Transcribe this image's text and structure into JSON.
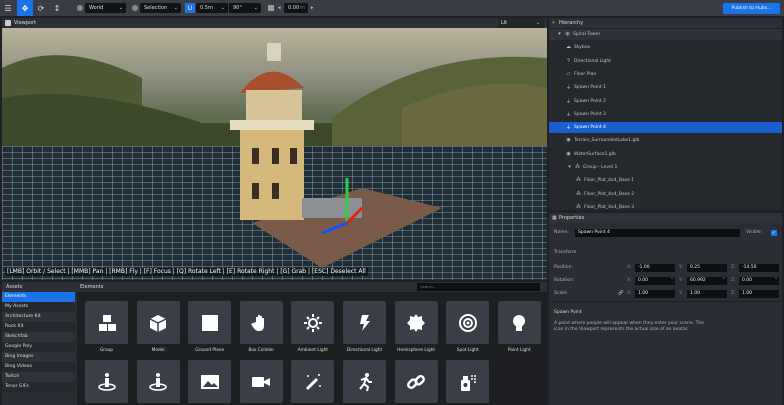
{
  "toolbar": {
    "menu_icon": "menu-icon",
    "move_icon": "move-icon",
    "rotate_icon": "rotate-icon",
    "scale_icon": "scale-icon",
    "space": "World",
    "pivot": "Selection",
    "snap_translate": "0.5m",
    "snap_rotate": "90°",
    "grid_height": "0.00",
    "grid_unit": "m",
    "publish_label": "Publish to Hubs..."
  },
  "viewport": {
    "title": "Viewport",
    "render_mode": "Lit",
    "hint": "[LMB] Orbit / Select | [MMB] Pan | [RMB] Fly | [F] Focus | [Q] Rotate Left | [E] Rotate Right | [G] Grab | [ESC] Deselect All"
  },
  "assets": {
    "title": "Assets",
    "sources": [
      "Elements",
      "My Assets",
      "Architecture Kit",
      "Rock Kit",
      "Sketchfab",
      "Google Poly",
      "Bing Images",
      "Bing Videos",
      "Twitch",
      "Tenor GIFs"
    ],
    "active_source": "Elements",
    "elements_title": "Elements",
    "search_placeholder": "Search...",
    "elements": [
      {
        "label": "Group",
        "icon": "cubes-icon"
      },
      {
        "label": "Model",
        "icon": "cube-icon"
      },
      {
        "label": "Ground Plane",
        "icon": "square-icon"
      },
      {
        "label": "Box Collider",
        "icon": "hand-icon"
      },
      {
        "label": "Ambient Light",
        "icon": "sun-icon"
      },
      {
        "label": "Directional Light",
        "icon": "bolt-icon"
      },
      {
        "label": "Hemisphere Light",
        "icon": "certificate-icon"
      },
      {
        "label": "Spot Light",
        "icon": "bullseye-icon"
      },
      {
        "label": "Point Light",
        "icon": "lightbulb-icon"
      },
      {
        "label": "",
        "icon": "spawn-point-icon"
      },
      {
        "label": "",
        "icon": "spawn-point-icon"
      },
      {
        "label": "",
        "icon": "image-icon"
      },
      {
        "label": "",
        "icon": "video-icon"
      },
      {
        "label": "",
        "icon": "magic-wand-icon"
      },
      {
        "label": "",
        "icon": "running-icon"
      },
      {
        "label": "",
        "icon": "link-icon"
      },
      {
        "label": "",
        "icon": "spray-can-icon"
      }
    ]
  },
  "hierarchy": {
    "title": "Hierarchy",
    "items": [
      {
        "label": "Spiral Tower",
        "icon": "globe-icon",
        "depth": 0,
        "expanded": true
      },
      {
        "label": "Skybox",
        "icon": "cloud-icon",
        "depth": 1
      },
      {
        "label": "Directional Light",
        "icon": "bolt-icon",
        "depth": 1
      },
      {
        "label": "Floor Plan",
        "icon": "floor-plan-icon",
        "depth": 1
      },
      {
        "label": "Spawn Point 1",
        "icon": "spawn-point-icon",
        "depth": 1
      },
      {
        "label": "Spawn Point 2",
        "icon": "spawn-point-icon",
        "depth": 1
      },
      {
        "label": "Spawn Point 3",
        "icon": "spawn-point-icon",
        "depth": 1
      },
      {
        "label": "Spawn Point 4",
        "icon": "spawn-point-icon",
        "depth": 1,
        "selected": true
      },
      {
        "label": "Terrain_SurroundedLake1.glb",
        "icon": "model-icon",
        "depth": 1
      },
      {
        "label": "WaterSurface1.glb",
        "icon": "model-icon",
        "depth": 1
      },
      {
        "label": "Group - Level 1",
        "icon": "cubes-icon",
        "depth": 1,
        "expanded": true
      },
      {
        "label": "Floor_Plat_4x4_Base 1",
        "icon": "cubes-icon",
        "depth": 2
      },
      {
        "label": "Floor_Plat_4x4_Base 2",
        "icon": "cubes-icon",
        "depth": 2
      },
      {
        "label": "Floor_Plat_4x4_Base 3",
        "icon": "cubes-icon",
        "depth": 2
      }
    ]
  },
  "properties": {
    "title": "Properties",
    "name_label": "Name:",
    "name_value": "Spawn Point 4",
    "visible_label": "Visible:",
    "visible": true,
    "transform_label": "Transform",
    "position_label": "Position:",
    "position": {
      "x": "-1.00",
      "y": "0.25",
      "z": "-14.50"
    },
    "rotation_label": "Rotation:",
    "rotation": {
      "x": "0.00",
      "y": "60.992",
      "z": "0.00"
    },
    "scale_label": "Scale:",
    "scale": {
      "x": "1.00",
      "y": "1.00",
      "z": "1.00"
    },
    "component_title": "Spawn Point",
    "component_desc": "A point where people will appear when they enter your scene. The icon in the Viewport represents the actual size of an avatar.",
    "x_label": "X:",
    "y_label": "Y:",
    "z_label": "Z:",
    "degree": "°"
  },
  "colors": {
    "accent": "#1a73e8",
    "background": "#1f2126",
    "panel": "#2a2d33"
  }
}
